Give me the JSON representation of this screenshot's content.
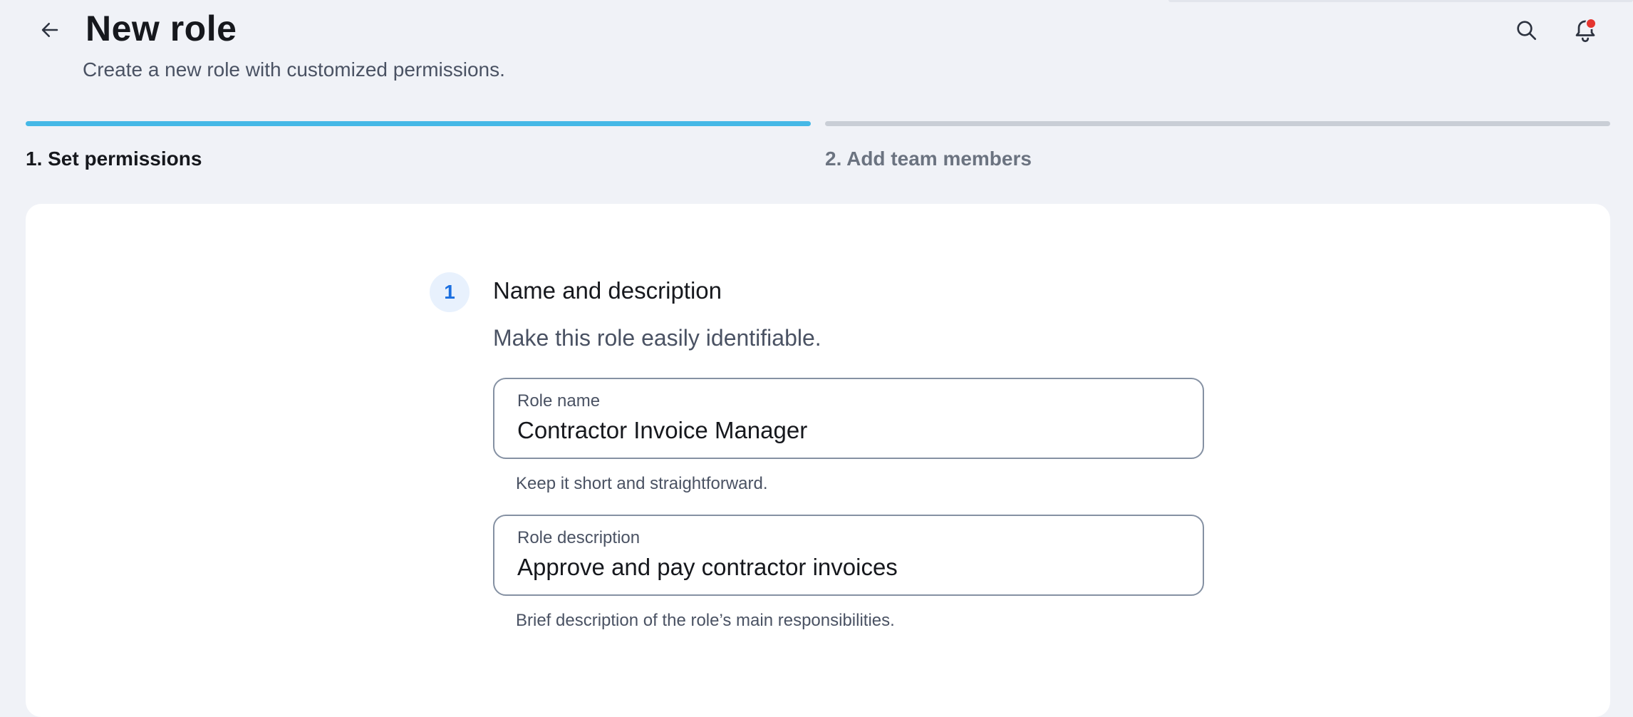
{
  "header": {
    "title": "New role",
    "subtitle": "Create a new role with customized permissions.",
    "back_icon": "arrow-left-icon",
    "search_icon": "search-icon",
    "notifications_icon": "bell-icon",
    "has_notification": true
  },
  "stepper": {
    "steps": [
      {
        "label": "1. Set permissions",
        "active": true
      },
      {
        "label": "2. Add team members",
        "active": false
      }
    ]
  },
  "section": {
    "number": "1",
    "title": "Name and description",
    "description": "Make this role easily identifiable."
  },
  "form": {
    "role_name": {
      "label": "Role name",
      "value": "Contractor Invoice Manager",
      "helper": "Keep it short and straightforward."
    },
    "role_description": {
      "label": "Role description",
      "value": "Approve and pay contractor invoices",
      "helper": "Brief description of the role’s main responsibilities."
    }
  },
  "colors": {
    "background": "#f0f2f7",
    "active_step": "#45b8e6",
    "inactive_step": "#c9ced6",
    "notification_dot": "#e5352f",
    "step_badge_text": "#1b6fe0",
    "step_badge_bg": "#e8f1fd"
  }
}
